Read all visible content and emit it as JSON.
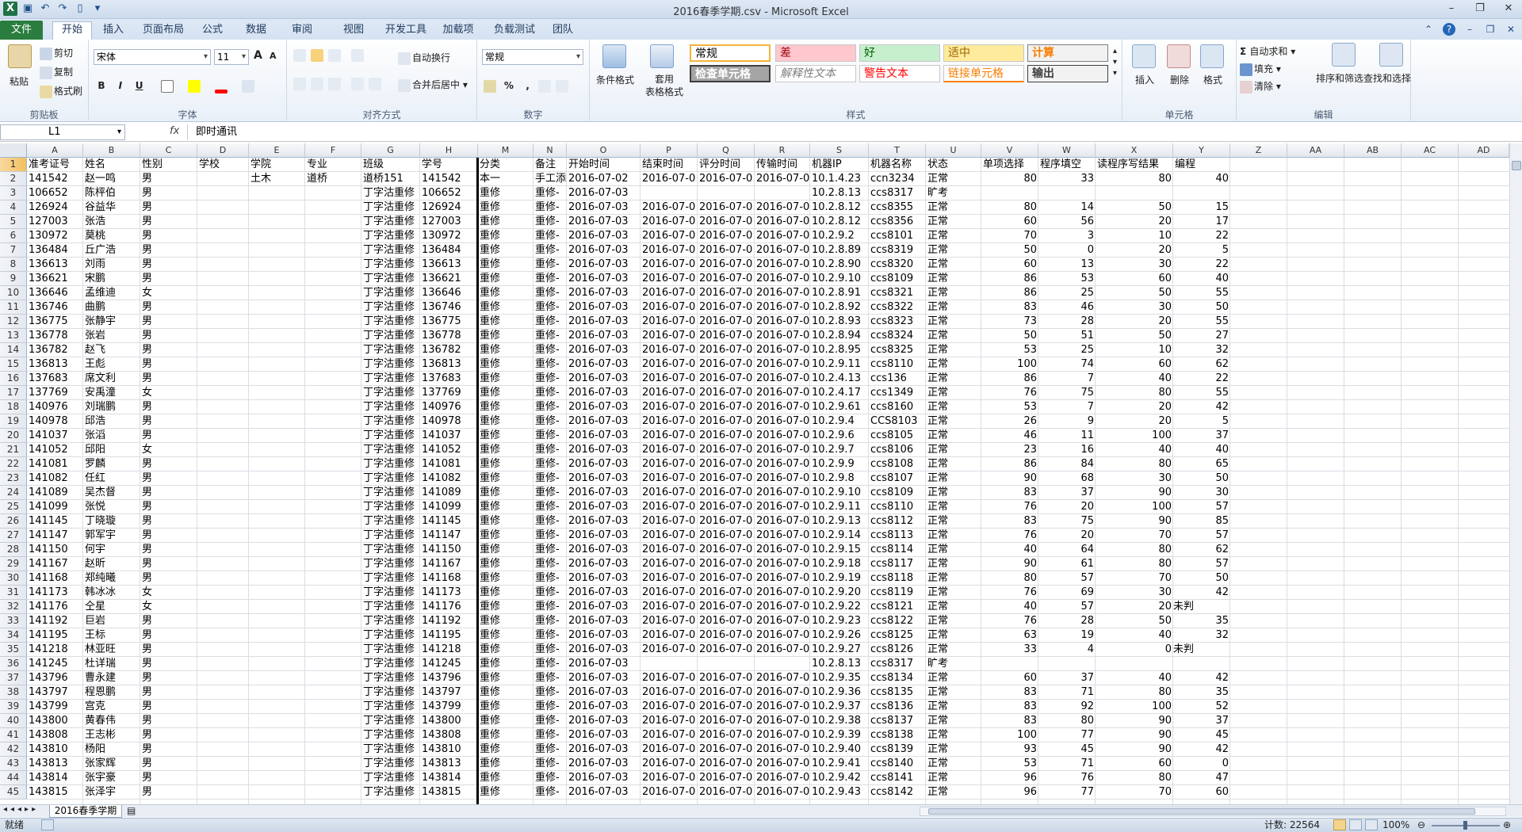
{
  "app": {
    "title": "2016春季学期.csv - Microsoft Excel"
  },
  "tabs": [
    "文件",
    "开始",
    "插入",
    "页面布局",
    "公式",
    "数据",
    "审阅",
    "视图",
    "开发工具",
    "加载项",
    "负载测试",
    "团队"
  ],
  "ribbon": {
    "clipboard": {
      "label": "剪贴板",
      "paste": "粘贴",
      "cut": "剪切",
      "copy": "复制",
      "format_painter": "格式刷"
    },
    "font": {
      "label": "字体",
      "name": "宋体",
      "size": "11",
      "bold": "B",
      "italic": "I",
      "underline": "U",
      "grow": "A",
      "shrink": "A"
    },
    "align": {
      "label": "对齐方式",
      "wrap": "自动换行",
      "merge": "合并后居中"
    },
    "number": {
      "label": "数字",
      "format": "常规",
      "percent": "%",
      "comma": ","
    },
    "styles": {
      "label": "样式",
      "cond": "条件格式",
      "table": "套用\n表格格式",
      "items": [
        {
          "text": "常规",
          "bg": "#ffffff",
          "color": "#000000"
        },
        {
          "text": "差",
          "bg": "#ffc7ce",
          "color": "#9c0006"
        },
        {
          "text": "好",
          "bg": "#c6efce",
          "color": "#006100"
        },
        {
          "text": "适中",
          "bg": "#ffeb9c",
          "color": "#9c6500"
        },
        {
          "text": "计算",
          "bg": "#f2f2f2",
          "color": "#fa7d00"
        },
        {
          "text": "检查单元格",
          "bg": "#a5a5a5",
          "color": "#ffffff"
        },
        {
          "text": "解释性文本",
          "bg": "#ffffff",
          "color": "#7f7f7f"
        },
        {
          "text": "警告文本",
          "bg": "#ffffff",
          "color": "#ff0000"
        },
        {
          "text": "链接单元格",
          "bg": "#ffffff",
          "color": "#fa7d00"
        },
        {
          "text": "输出",
          "bg": "#f2f2f2",
          "color": "#3f3f3f"
        }
      ]
    },
    "cells": {
      "label": "单元格",
      "insert": "插入",
      "delete": "删除",
      "format": "格式"
    },
    "editing": {
      "label": "编辑",
      "autosum": "自动求和",
      "fill": "填充",
      "clear": "清除",
      "sort": "排序和筛选",
      "find": "查找和选择"
    }
  },
  "formula": {
    "namebox": "L1",
    "fx": "fx",
    "value": "即时通讯"
  },
  "columns": [
    "A",
    "B",
    "C",
    "D",
    "E",
    "F",
    "G",
    "H",
    "M",
    "N",
    "O",
    "P",
    "Q",
    "R",
    "S",
    "T",
    "U",
    "V",
    "W",
    "X",
    "Y",
    "Z",
    "AA",
    "AB",
    "AC",
    "AD"
  ],
  "selected_col": "L",
  "rows": [
    [
      "准考证号",
      "姓名",
      "性别",
      "学校",
      "学院",
      "专业",
      "班级",
      "学号",
      "分类",
      "备注",
      "开始时间",
      "结束时间",
      "评分时间",
      "传输时间",
      "机器IP",
      "机器名称",
      "状态",
      "单项选择",
      "程序填空",
      "读程序写结果",
      "编程"
    ],
    [
      "141542",
      "赵一鸣",
      "男",
      "",
      "土木",
      "道桥",
      "道桥151",
      "141542",
      "本一",
      "手工添",
      "2016-07-02",
      "2016-07-0",
      "2016-07-0",
      "2016-07-0",
      "10.1.4.23",
      "ccn3234",
      "正常",
      "80",
      "33",
      "80",
      "40"
    ],
    [
      "106652",
      "陈枰伯",
      "男",
      "",
      "",
      "",
      "丁字沽重修",
      "106652",
      "重修",
      "重修-",
      "2016-07-03",
      "",
      "",
      "",
      "10.2.8.13",
      "ccs8317",
      "旷考",
      "",
      "",
      "",
      ""
    ],
    [
      "126924",
      "谷益华",
      "男",
      "",
      "",
      "",
      "丁字沽重修",
      "126924",
      "重修",
      "重修-",
      "2016-07-03",
      "2016-07-0",
      "2016-07-0",
      "2016-07-0",
      "10.2.8.12",
      "ccs8355",
      "正常",
      "80",
      "14",
      "50",
      "15"
    ],
    [
      "127003",
      "张浩",
      "男",
      "",
      "",
      "",
      "丁字沽重修",
      "127003",
      "重修",
      "重修-",
      "2016-07-03",
      "2016-07-0",
      "2016-07-0",
      "2016-07-0",
      "10.2.8.12",
      "ccs8356",
      "正常",
      "60",
      "56",
      "20",
      "17"
    ],
    [
      "130972",
      "莫桃",
      "男",
      "",
      "",
      "",
      "丁字沽重修",
      "130972",
      "重修",
      "重修-",
      "2016-07-03",
      "2016-07-0",
      "2016-07-0",
      "2016-07-0",
      "10.2.9.2",
      "ccs8101",
      "正常",
      "70",
      "3",
      "10",
      "22"
    ],
    [
      "136484",
      "丘广浩",
      "男",
      "",
      "",
      "",
      "丁字沽重修",
      "136484",
      "重修",
      "重修-",
      "2016-07-03",
      "2016-07-0",
      "2016-07-0",
      "2016-07-0",
      "10.2.8.89",
      "ccs8319",
      "正常",
      "50",
      "0",
      "20",
      "5"
    ],
    [
      "136613",
      "刘雨",
      "男",
      "",
      "",
      "",
      "丁字沽重修",
      "136613",
      "重修",
      "重修-",
      "2016-07-03",
      "2016-07-0",
      "2016-07-0",
      "2016-07-0",
      "10.2.8.90",
      "ccs8320",
      "正常",
      "60",
      "13",
      "30",
      "22"
    ],
    [
      "136621",
      "宋鹏",
      "男",
      "",
      "",
      "",
      "丁字沽重修",
      "136621",
      "重修",
      "重修-",
      "2016-07-03",
      "2016-07-0",
      "2016-07-0",
      "2016-07-0",
      "10.2.9.10",
      "ccs8109",
      "正常",
      "86",
      "53",
      "60",
      "40"
    ],
    [
      "136646",
      "孟维迪",
      "女",
      "",
      "",
      "",
      "丁字沽重修",
      "136646",
      "重修",
      "重修-",
      "2016-07-03",
      "2016-07-0",
      "2016-07-0",
      "2016-07-0",
      "10.2.8.91",
      "ccs8321",
      "正常",
      "86",
      "25",
      "50",
      "55"
    ],
    [
      "136746",
      "曲鹏",
      "男",
      "",
      "",
      "",
      "丁字沽重修",
      "136746",
      "重修",
      "重修-",
      "2016-07-03",
      "2016-07-0",
      "2016-07-0",
      "2016-07-0",
      "10.2.8.92",
      "ccs8322",
      "正常",
      "83",
      "46",
      "30",
      "50"
    ],
    [
      "136775",
      "张静宇",
      "男",
      "",
      "",
      "",
      "丁字沽重修",
      "136775",
      "重修",
      "重修-",
      "2016-07-03",
      "2016-07-0",
      "2016-07-0",
      "2016-07-0",
      "10.2.8.93",
      "ccs8323",
      "正常",
      "73",
      "28",
      "20",
      "55"
    ],
    [
      "136778",
      "张岩",
      "男",
      "",
      "",
      "",
      "丁字沽重修",
      "136778",
      "重修",
      "重修-",
      "2016-07-03",
      "2016-07-0",
      "2016-07-0",
      "2016-07-0",
      "10.2.8.94",
      "ccs8324",
      "正常",
      "50",
      "51",
      "50",
      "27"
    ],
    [
      "136782",
      "赵飞",
      "男",
      "",
      "",
      "",
      "丁字沽重修",
      "136782",
      "重修",
      "重修-",
      "2016-07-03",
      "2016-07-0",
      "2016-07-0",
      "2016-07-0",
      "10.2.8.95",
      "ccs8325",
      "正常",
      "53",
      "25",
      "10",
      "32"
    ],
    [
      "136813",
      "王彪",
      "男",
      "",
      "",
      "",
      "丁字沽重修",
      "136813",
      "重修",
      "重修-",
      "2016-07-03",
      "2016-07-0",
      "2016-07-0",
      "2016-07-0",
      "10.2.9.11",
      "ccs8110",
      "正常",
      "100",
      "74",
      "60",
      "62"
    ],
    [
      "137683",
      "席文利",
      "男",
      "",
      "",
      "",
      "丁字沽重修",
      "137683",
      "重修",
      "重修-",
      "2016-07-03",
      "2016-07-0",
      "2016-07-0",
      "2016-07-0",
      "10.2.4.13",
      "ccs136",
      "正常",
      "86",
      "7",
      "40",
      "22"
    ],
    [
      "137769",
      "安禹潼",
      "女",
      "",
      "",
      "",
      "丁字沽重修",
      "137769",
      "重修",
      "重修-",
      "2016-07-03",
      "2016-07-0",
      "2016-07-0",
      "2016-07-0",
      "10.2.4.17",
      "ccs1349",
      "正常",
      "76",
      "75",
      "80",
      "55"
    ],
    [
      "140976",
      "刘瑞鹏",
      "男",
      "",
      "",
      "",
      "丁字沽重修",
      "140976",
      "重修",
      "重修-",
      "2016-07-03",
      "2016-07-0",
      "2016-07-0",
      "2016-07-0",
      "10.2.9.61",
      "ccs8160",
      "正常",
      "53",
      "7",
      "20",
      "42"
    ],
    [
      "140978",
      "邱浩",
      "男",
      "",
      "",
      "",
      "丁字沽重修",
      "140978",
      "重修",
      "重修-",
      "2016-07-03",
      "2016-07-0",
      "2016-07-0",
      "2016-07-0",
      "10.2.9.4",
      "CCS8103",
      "正常",
      "26",
      "9",
      "20",
      "5"
    ],
    [
      "141037",
      "张滔",
      "男",
      "",
      "",
      "",
      "丁字沽重修",
      "141037",
      "重修",
      "重修-",
      "2016-07-03",
      "2016-07-0",
      "2016-07-0",
      "2016-07-0",
      "10.2.9.6",
      "ccs8105",
      "正常",
      "46",
      "11",
      "100",
      "37"
    ],
    [
      "141052",
      "邱阳",
      "女",
      "",
      "",
      "",
      "丁字沽重修",
      "141052",
      "重修",
      "重修-",
      "2016-07-03",
      "2016-07-0",
      "2016-07-0",
      "2016-07-0",
      "10.2.9.7",
      "ccs8106",
      "正常",
      "23",
      "16",
      "40",
      "40"
    ],
    [
      "141081",
      "罗麟",
      "男",
      "",
      "",
      "",
      "丁字沽重修",
      "141081",
      "重修",
      "重修-",
      "2016-07-03",
      "2016-07-0",
      "2016-07-0",
      "2016-07-0",
      "10.2.9.9",
      "ccs8108",
      "正常",
      "86",
      "84",
      "80",
      "65"
    ],
    [
      "141082",
      "任红",
      "男",
      "",
      "",
      "",
      "丁字沽重修",
      "141082",
      "重修",
      "重修-",
      "2016-07-03",
      "2016-07-0",
      "2016-07-0",
      "2016-07-0",
      "10.2.9.8",
      "ccs8107",
      "正常",
      "90",
      "68",
      "30",
      "50"
    ],
    [
      "141089",
      "吴杰督",
      "男",
      "",
      "",
      "",
      "丁字沽重修",
      "141089",
      "重修",
      "重修-",
      "2016-07-03",
      "2016-07-0",
      "2016-07-0",
      "2016-07-0",
      "10.2.9.10",
      "ccs8109",
      "正常",
      "83",
      "37",
      "90",
      "30"
    ],
    [
      "141099",
      "张悦",
      "男",
      "",
      "",
      "",
      "丁字沽重修",
      "141099",
      "重修",
      "重修-",
      "2016-07-03",
      "2016-07-0",
      "2016-07-0",
      "2016-07-0",
      "10.2.9.11",
      "ccs8110",
      "正常",
      "76",
      "20",
      "100",
      "57"
    ],
    [
      "141145",
      "丁晓璇",
      "男",
      "",
      "",
      "",
      "丁字沽重修",
      "141145",
      "重修",
      "重修-",
      "2016-07-03",
      "2016-07-0",
      "2016-07-0",
      "2016-07-0",
      "10.2.9.13",
      "ccs8112",
      "正常",
      "83",
      "75",
      "90",
      "85"
    ],
    [
      "141147",
      "郭军宇",
      "男",
      "",
      "",
      "",
      "丁字沽重修",
      "141147",
      "重修",
      "重修-",
      "2016-07-03",
      "2016-07-0",
      "2016-07-0",
      "2016-07-0",
      "10.2.9.14",
      "ccs8113",
      "正常",
      "76",
      "20",
      "70",
      "57"
    ],
    [
      "141150",
      "何宇",
      "男",
      "",
      "",
      "",
      "丁字沽重修",
      "141150",
      "重修",
      "重修-",
      "2016-07-03",
      "2016-07-0",
      "2016-07-0",
      "2016-07-0",
      "10.2.9.15",
      "ccs8114",
      "正常",
      "40",
      "64",
      "80",
      "62"
    ],
    [
      "141167",
      "赵昕",
      "男",
      "",
      "",
      "",
      "丁字沽重修",
      "141167",
      "重修",
      "重修-",
      "2016-07-03",
      "2016-07-0",
      "2016-07-0",
      "2016-07-0",
      "10.2.9.18",
      "ccs8117",
      "正常",
      "90",
      "61",
      "80",
      "57"
    ],
    [
      "141168",
      "郑纯曦",
      "男",
      "",
      "",
      "",
      "丁字沽重修",
      "141168",
      "重修",
      "重修-",
      "2016-07-03",
      "2016-07-0",
      "2016-07-0",
      "2016-07-0",
      "10.2.9.19",
      "ccs8118",
      "正常",
      "80",
      "57",
      "70",
      "50"
    ],
    [
      "141173",
      "韩冰冰",
      "女",
      "",
      "",
      "",
      "丁字沽重修",
      "141173",
      "重修",
      "重修-",
      "2016-07-03",
      "2016-07-0",
      "2016-07-0",
      "2016-07-0",
      "10.2.9.20",
      "ccs8119",
      "正常",
      "76",
      "69",
      "30",
      "42"
    ],
    [
      "141176",
      "仝星",
      "女",
      "",
      "",
      "",
      "丁字沽重修",
      "141176",
      "重修",
      "重修-",
      "2016-07-03",
      "2016-07-0",
      "2016-07-0",
      "2016-07-0",
      "10.2.9.22",
      "ccs8121",
      "正常",
      "40",
      "57",
      "20",
      "未判"
    ],
    [
      "141192",
      "巨岩",
      "男",
      "",
      "",
      "",
      "丁字沽重修",
      "141192",
      "重修",
      "重修-",
      "2016-07-03",
      "2016-07-0",
      "2016-07-0",
      "2016-07-0",
      "10.2.9.23",
      "ccs8122",
      "正常",
      "76",
      "28",
      "50",
      "35"
    ],
    [
      "141195",
      "王标",
      "男",
      "",
      "",
      "",
      "丁字沽重修",
      "141195",
      "重修",
      "重修-",
      "2016-07-03",
      "2016-07-0",
      "2016-07-0",
      "2016-07-0",
      "10.2.9.26",
      "ccs8125",
      "正常",
      "63",
      "19",
      "40",
      "32"
    ],
    [
      "141218",
      "林亚旺",
      "男",
      "",
      "",
      "",
      "丁字沽重修",
      "141218",
      "重修",
      "重修-",
      "2016-07-03",
      "2016-07-0",
      "2016-07-0",
      "2016-07-0",
      "10.2.9.27",
      "ccs8126",
      "正常",
      "33",
      "4",
      "0",
      "未判"
    ],
    [
      "141245",
      "杜详瑞",
      "男",
      "",
      "",
      "",
      "丁字沽重修",
      "141245",
      "重修",
      "重修-",
      "2016-07-03",
      "",
      "",
      "",
      "10.2.8.13",
      "ccs8317",
      "旷考",
      "",
      "",
      "",
      ""
    ],
    [
      "143796",
      "曹永建",
      "男",
      "",
      "",
      "",
      "丁字沽重修",
      "143796",
      "重修",
      "重修-",
      "2016-07-03",
      "2016-07-0",
      "2016-07-0",
      "2016-07-0",
      "10.2.9.35",
      "ccs8134",
      "正常",
      "60",
      "37",
      "40",
      "42"
    ],
    [
      "143797",
      "程恩鹏",
      "男",
      "",
      "",
      "",
      "丁字沽重修",
      "143797",
      "重修",
      "重修-",
      "2016-07-03",
      "2016-07-0",
      "2016-07-0",
      "2016-07-0",
      "10.2.9.36",
      "ccs8135",
      "正常",
      "83",
      "71",
      "80",
      "35"
    ],
    [
      "143799",
      "宫克",
      "男",
      "",
      "",
      "",
      "丁字沽重修",
      "143799",
      "重修",
      "重修-",
      "2016-07-03",
      "2016-07-0",
      "2016-07-0",
      "2016-07-0",
      "10.2.9.37",
      "ccs8136",
      "正常",
      "83",
      "92",
      "100",
      "52"
    ],
    [
      "143800",
      "黄春伟",
      "男",
      "",
      "",
      "",
      "丁字沽重修",
      "143800",
      "重修",
      "重修-",
      "2016-07-03",
      "2016-07-0",
      "2016-07-0",
      "2016-07-0",
      "10.2.9.38",
      "ccs8137",
      "正常",
      "83",
      "80",
      "90",
      "37"
    ],
    [
      "143808",
      "王志彬",
      "男",
      "",
      "",
      "",
      "丁字沽重修",
      "143808",
      "重修",
      "重修-",
      "2016-07-03",
      "2016-07-0",
      "2016-07-0",
      "2016-07-0",
      "10.2.9.39",
      "ccs8138",
      "正常",
      "100",
      "77",
      "90",
      "45"
    ],
    [
      "143810",
      "杨阳",
      "男",
      "",
      "",
      "",
      "丁字沽重修",
      "143810",
      "重修",
      "重修-",
      "2016-07-03",
      "2016-07-0",
      "2016-07-0",
      "2016-07-0",
      "10.2.9.40",
      "ccs8139",
      "正常",
      "93",
      "45",
      "90",
      "42"
    ],
    [
      "143813",
      "张家辉",
      "男",
      "",
      "",
      "",
      "丁字沽重修",
      "143813",
      "重修",
      "重修-",
      "2016-07-03",
      "2016-07-0",
      "2016-07-0",
      "2016-07-0",
      "10.2.9.41",
      "ccs8140",
      "正常",
      "53",
      "71",
      "60",
      "0"
    ],
    [
      "143814",
      "张宇豪",
      "男",
      "",
      "",
      "",
      "丁字沽重修",
      "143814",
      "重修",
      "重修-",
      "2016-07-03",
      "2016-07-0",
      "2016-07-0",
      "2016-07-0",
      "10.2.9.42",
      "ccs8141",
      "正常",
      "96",
      "76",
      "80",
      "47"
    ],
    [
      "143815",
      "张泽宇",
      "男",
      "",
      "",
      "",
      "丁字沽重修",
      "143815",
      "重修",
      "重修-",
      "2016-07-03",
      "2016-07-0",
      "2016-07-0",
      "2016-07-0",
      "10.2.9.43",
      "ccs8142",
      "正常",
      "96",
      "77",
      "70",
      "60"
    ]
  ],
  "sheet": {
    "tab": "2016春季学期"
  },
  "status": {
    "ready": "就绪",
    "count": "计数: 22564",
    "zoom": "100%"
  }
}
